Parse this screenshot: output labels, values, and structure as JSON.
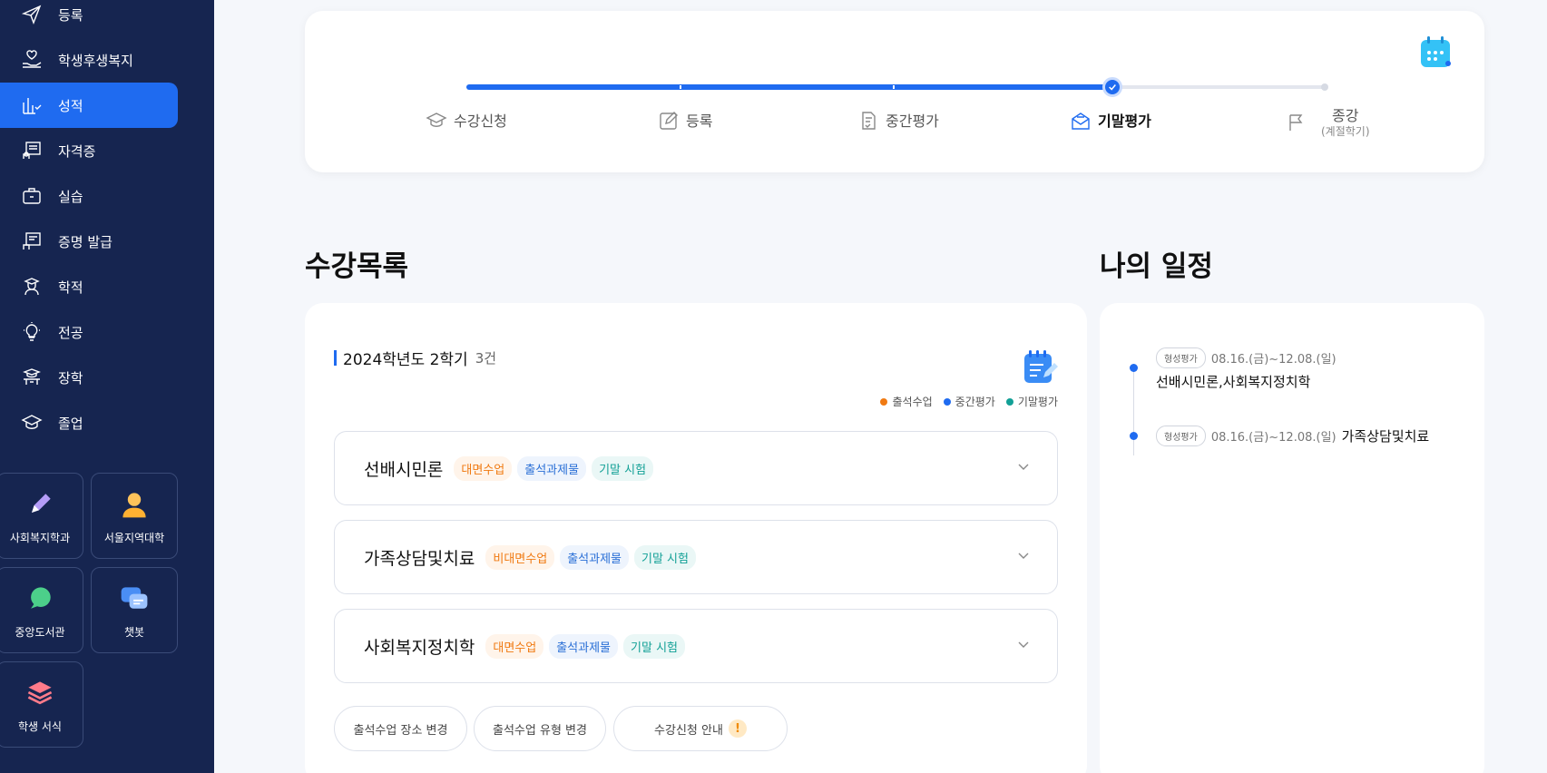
{
  "sidebar": {
    "items": [
      {
        "label": "등록",
        "icon": "paper-plane-icon"
      },
      {
        "label": "학생후생복지",
        "icon": "hand-heart-icon"
      },
      {
        "label": "성적",
        "icon": "grade-chart-icon",
        "active": true
      },
      {
        "label": "자격증",
        "icon": "certificate-icon"
      },
      {
        "label": "실습",
        "icon": "briefcase-icon"
      },
      {
        "label": "증명 발급",
        "icon": "document-issue-icon"
      },
      {
        "label": "학적",
        "icon": "student-icon"
      },
      {
        "label": "전공",
        "icon": "lightbulb-icon"
      },
      {
        "label": "장학",
        "icon": "scholarship-icon"
      },
      {
        "label": "졸업",
        "icon": "graduation-cap-icon"
      }
    ],
    "tiles": [
      {
        "label": "사회복지학과",
        "icon": "pencil-icon"
      },
      {
        "label": "서울지역대학",
        "icon": "person-icon"
      },
      {
        "label": "중앙도서관",
        "icon": "chat-bubble-icon"
      },
      {
        "label": "챗봇",
        "icon": "chatbot-icon"
      },
      {
        "label": "학생 서식",
        "icon": "layers-icon"
      }
    ]
  },
  "progress": {
    "steps": [
      {
        "label": "수강신청",
        "icon": "graduation-cap-icon"
      },
      {
        "label": "등록",
        "icon": "edit-icon"
      },
      {
        "label": "중간평가",
        "icon": "checklist-icon"
      },
      {
        "label": "기말평가",
        "icon": "mail-icon",
        "current": true
      },
      {
        "label": "종강",
        "sublabel": "(계절학기)",
        "icon": "flag-icon"
      }
    ]
  },
  "courses": {
    "section_title": "수강목록",
    "semester": "2024학년도 2학기",
    "count": "3건",
    "legend": [
      {
        "label": "출석수업",
        "color": "#f07a12"
      },
      {
        "label": "중간평가",
        "color": "#1f6bf0"
      },
      {
        "label": "기말평가",
        "color": "#12a096"
      }
    ],
    "list": [
      {
        "name": "선배시민론",
        "badges": [
          "대면수업",
          "출석과제물",
          "기말 시험"
        ]
      },
      {
        "name": "가족상담및치료",
        "badges": [
          "비대면수업",
          "출석과제물",
          "기말 시험"
        ]
      },
      {
        "name": "사회복지정치학",
        "badges": [
          "대면수업",
          "출석과제물",
          "기말 시험"
        ]
      }
    ],
    "buttons": {
      "change_place": "출석수업 장소 변경",
      "change_type": "출석수업 유형 변경",
      "guide": "수강신청 안내"
    }
  },
  "schedule": {
    "section_title": "나의 일정",
    "items": [
      {
        "tag": "형성평가",
        "date": "08.16.(금)~12.08.(일)",
        "title": "선배시민론,사회복지정치학"
      },
      {
        "tag": "형성평가",
        "date": "08.16.(금)~12.08.(일)",
        "title": "가족상담및치료"
      }
    ]
  }
}
